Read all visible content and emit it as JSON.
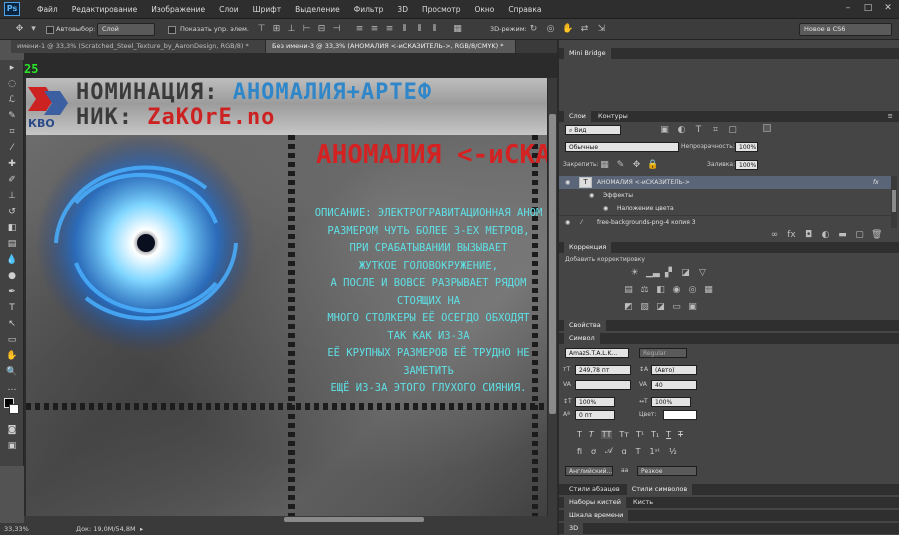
{
  "app": {
    "logo": "Ps"
  },
  "menu": [
    "Файл",
    "Редактирование",
    "Изображение",
    "Слои",
    "Шрифт",
    "Выделение",
    "Фильтр",
    "3D",
    "Просмотр",
    "Окно",
    "Справка"
  ],
  "options": {
    "autoselect_label": "Автовыбор:",
    "autoselect_value": "Слой",
    "show_controls_label": "Показать упр. элем.",
    "mode_3d": "3D-режим:",
    "workspace": "Новое в CS6"
  },
  "tabs": [
    {
      "label": "имени-1 @ 33,3% (Scratched_Steel_Texture_by_AaronDesign, RGB/8) *"
    },
    {
      "label": "Без имени-3 @ 33,3% (АНОМАЛИЯ <-иСКАЗИТЕЛЬ->, RGB/8/CMYK) *"
    }
  ],
  "canvas": {
    "ruler_value": "25",
    "banner_line1": "НОМИНАЦИЯ: АНОМАЛИЯ+АРТЕФ",
    "banner_line2": "НИК: ZаКОrЕ.nо",
    "banner_logo": "КВО",
    "title": "АНОМАЛИЯ <-иСКАЗ",
    "body_lines": [
      "ОПИСАНИЕ: ЭЛЕКТРОГРАВИТАЦИОННАЯ АНОМ",
      "РАЗМЕРОМ ЧУТЬ БОЛЕЕ 3-ЕХ МЕТРОВ,",
      "ПРИ СРАБАТЫВАНИИ ВЫЗЫВАЕТ",
      "ЖУТКОЕ ГОЛОВОКРУЖЕНИЕ,",
      "А ПОСЛЕ И ВОВСЕ РАЗРЫВАЕТ РЯДОМ СТОЯЩИХ НА",
      "МНОГО СТОЛКЕРЫ ЕЁ ОСЕГДО ОБХОДЯТ",
      "ТАК КАК ИЗ-ЗА",
      "ЕЁ КРУПНЫХ РАЗМЕРОВ ЕЁ ТРУДНО НЕ ЗАМЕТИТЬ",
      "ЕЩЁ ИЗ-ЗА ЭТОГО ГЛУХОГО СИЯНИЯ."
    ]
  },
  "status": {
    "zoom": "33,33%",
    "doc": "Док: 19,0M/54,8M"
  },
  "panels": {
    "mini_bridge": "Mini Bridge",
    "layers_tab": "Слои",
    "paths_tab": "Контуры",
    "filter_kind": "Вид",
    "blend_mode": "Обычные",
    "opacity_label": "Непрозрачность:",
    "opacity_value": "100%",
    "lock_label": "Закрепить:",
    "fill_label": "Заливка:",
    "fill_value": "100%",
    "layers": [
      {
        "name": "АНОМАЛИЯ <-иСКАЗИТЕЛЬ->",
        "fx": "fx"
      },
      {
        "name": "Эффекты"
      },
      {
        "name": "Наложение цвета"
      },
      {
        "name": "free-backgrounds-png-4 копия 3"
      }
    ],
    "adjustments_tab": "Коррекция",
    "adjustments_add": "Добавить корректировку",
    "properties_tab": "Свойства",
    "character_tab": "Символ",
    "font_family": "AmazS.T.A.L.K...",
    "font_style": "Regular",
    "font_size": "249,78 пт",
    "leading": "(Авто)",
    "kerning": "",
    "tracking": "40",
    "vscale": "100%",
    "hscale": "100%",
    "baseline": "0 пт",
    "color_label": "Цвет:",
    "language": "Английский...",
    "antialias": "Резкое",
    "aa_prefix": "aa",
    "para_styles_tab": "Стили абзацев",
    "char_styles_tab": "Стили символов",
    "brushes_tab": "Наборы кистей",
    "clone_tab": "Кисть",
    "timeline_tab": "Шкала времени",
    "threed_tab": "3D"
  },
  "colors": {
    "accent": "#4aa3e6",
    "canvas_title": "#d42222",
    "canvas_text": "#5fe0e6"
  }
}
